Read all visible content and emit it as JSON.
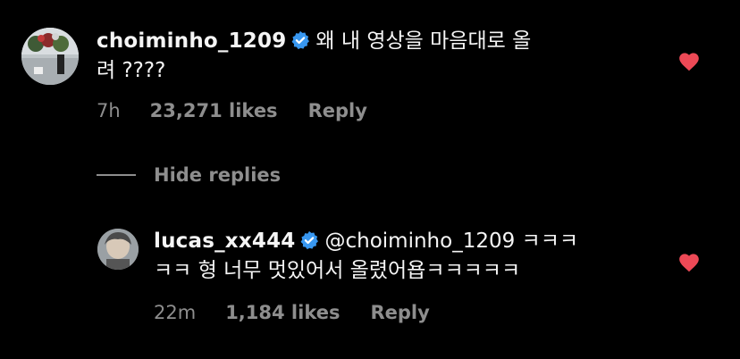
{
  "comments": [
    {
      "username": "choiminho_1209",
      "verified": true,
      "text_line1": "왜 내 영상을 마음대로 올",
      "text_line2": "려 ????",
      "time": "7h",
      "likes": "23,271 likes",
      "reply_label": "Reply",
      "liked": true,
      "heart_color": "#ed4956"
    },
    {
      "username": "lucas_xx444",
      "verified": true,
      "text_line1": "@choiminho_1209 ㅋㅋㅋ",
      "text_line2": "ㅋㅋ 형 너무 멋있어서 올렸어욥ㅋㅋㅋㅋㅋ",
      "time": "22m",
      "likes": "1,184 likes",
      "reply_label": "Reply",
      "liked": true,
      "heart_color": "#ed4956"
    }
  ],
  "hide_replies_label": "Hide replies",
  "colors": {
    "background": "#000000",
    "text": "#f5f5f5",
    "muted": "#8e8e8e",
    "verified": "#3897f0",
    "heart": "#ed4956"
  }
}
